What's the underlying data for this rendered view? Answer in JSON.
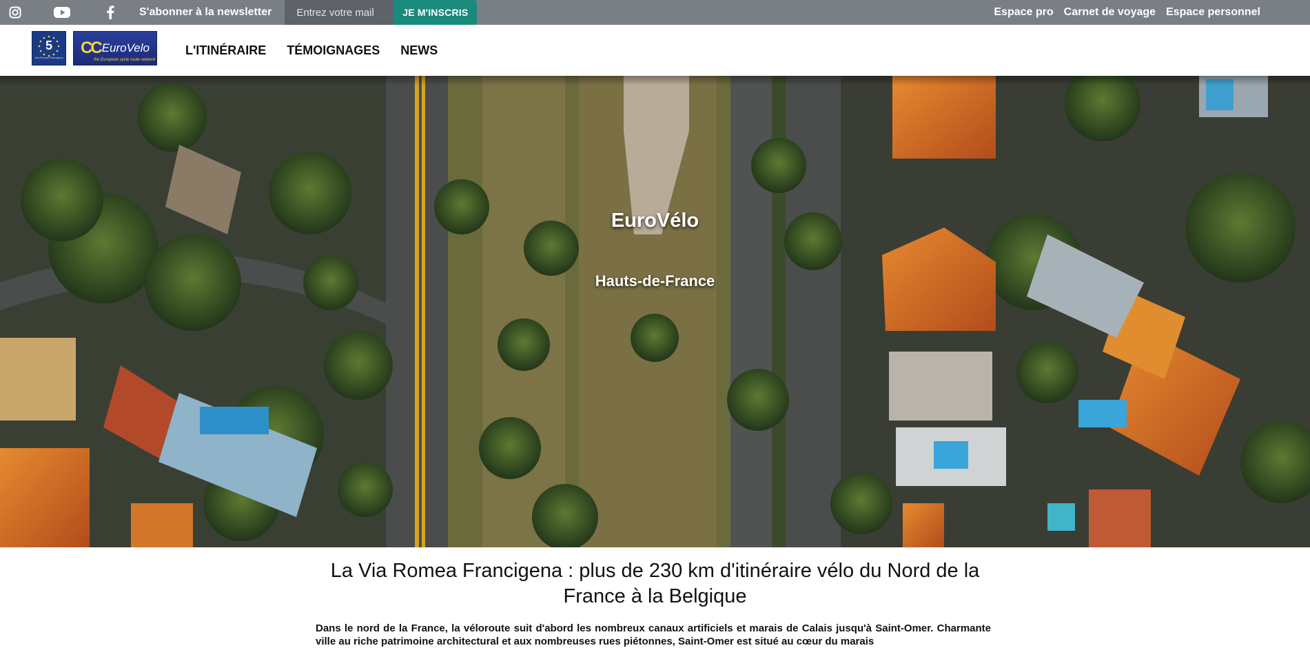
{
  "topbar": {
    "social": [
      {
        "icon": "instagram-icon"
      },
      {
        "icon": "youtube-icon"
      },
      {
        "icon": "facebook-icon"
      }
    ],
    "newsletter_label": "S'abonner à la newsletter",
    "email_placeholder": "Entrez votre mail",
    "subscribe_label": "JE M'INSCRIS",
    "links": [
      "Espace pro",
      "Carnet de voyage",
      "Espace personnel"
    ]
  },
  "nav": {
    "logo_route_number": "5",
    "logo_route_caption": "Via Romea Francigena",
    "logo_eurovelo_text": "EuroVelo",
    "logo_eurovelo_tagline": "the European cycle route network",
    "items": [
      "L'ITINÉRAIRE",
      "TÉMOIGNAGES",
      "NEWS"
    ]
  },
  "hero": {
    "title": "EuroVélo",
    "subtitle": "Hauts-de-France"
  },
  "article": {
    "title": "La Via Romea Francigena : plus de 230 km d'itinéraire vélo du Nord de la France à la Belgique",
    "intro": "Dans le nord de la France, la véloroute suit d'abord les nombreux canaux artificiels et marais de Calais jusqu'à Saint-Omer. Charmante ville au riche patrimoine architectural et aux nombreuses rues piétonnes, Saint-Omer est situé au cœur du marais"
  },
  "colors": {
    "topbar_bg": "#7a7f86",
    "subscribe_bg": "#1a8a7d",
    "logo_blue": "#1b3a86",
    "logo_yellow": "#f3d633"
  }
}
